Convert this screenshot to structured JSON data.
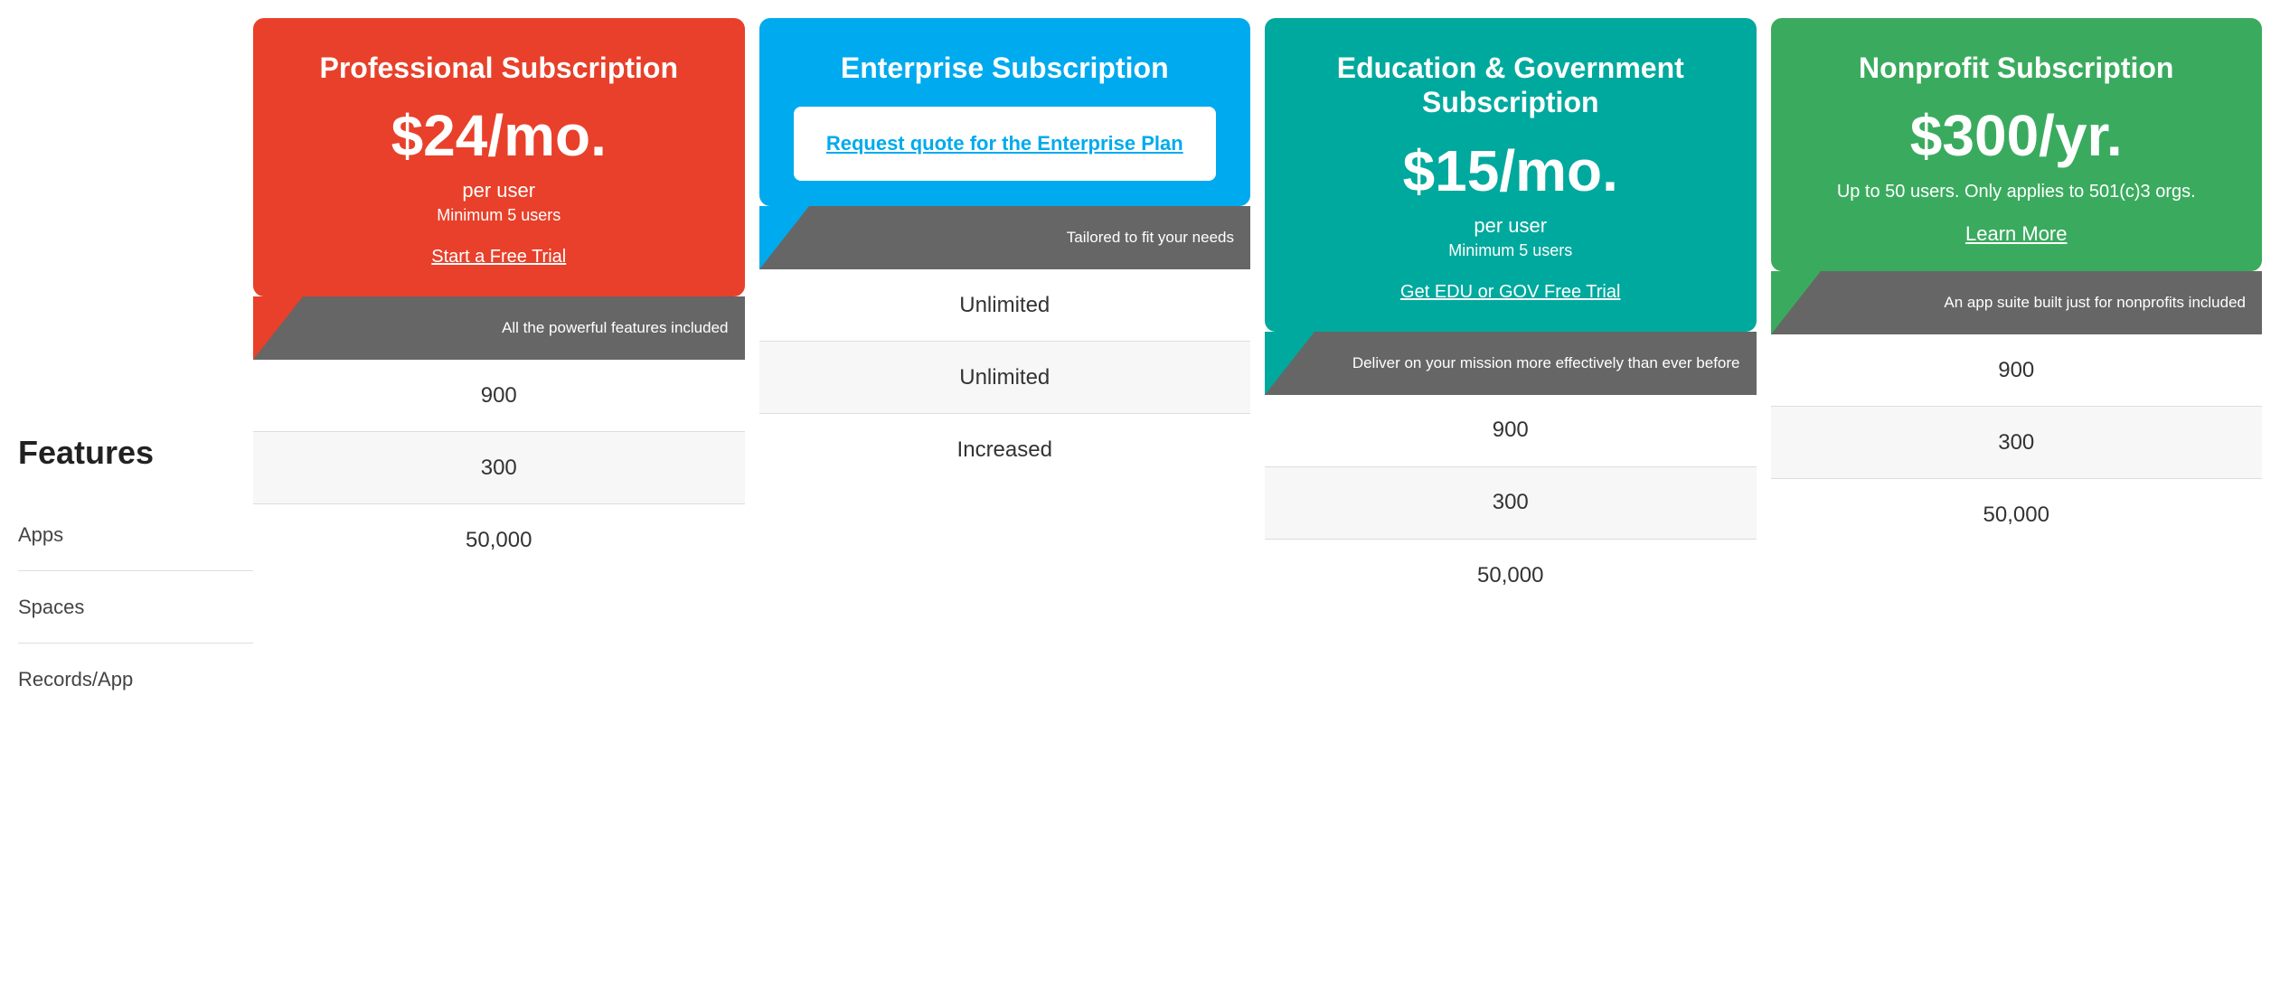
{
  "features_section": {
    "title": "Features",
    "rows": [
      {
        "label": "Apps"
      },
      {
        "label": "Spaces"
      },
      {
        "label": "Records/App"
      }
    ]
  },
  "plans": [
    {
      "id": "professional",
      "title": "Professional Subscription",
      "price": "$24/mo.",
      "per_user": "per user",
      "min_users": "Minimum 5 users",
      "cta_text": "Start a Free Trial",
      "cta_type": "link",
      "description": "All the powerful features included",
      "color_class": "professional",
      "features": [
        "900",
        "300",
        "50,000"
      ]
    },
    {
      "id": "enterprise",
      "title": "Enterprise Subscription",
      "price": null,
      "cta_type": "box",
      "cta_box_text": "Request quote for the Enterprise Plan",
      "description": "Tailored to fit your needs",
      "color_class": "enterprise",
      "features": [
        "Unlimited",
        "Unlimited",
        "Increased"
      ]
    },
    {
      "id": "edu-gov",
      "title": "Education & Government Subscription",
      "price": "$15/mo.",
      "per_user": "per user",
      "min_users": "Minimum 5 users",
      "cta_text": "Get EDU or GOV Free Trial",
      "cta_type": "link",
      "description": "Deliver on your mission more effectively than ever before",
      "color_class": "edu-gov",
      "features": [
        "900",
        "300",
        "50,000"
      ]
    },
    {
      "id": "nonprofit",
      "title": "Nonprofit Subscription",
      "price": "$300/yr.",
      "nonprofit_desc": "Up to 50 users. Only applies to 501(c)3 orgs.",
      "cta_text": "Learn More",
      "cta_type": "link",
      "description": "An app suite built just for nonprofits included",
      "color_class": "nonprofit",
      "features": [
        "900",
        "300",
        "50,000"
      ]
    }
  ]
}
